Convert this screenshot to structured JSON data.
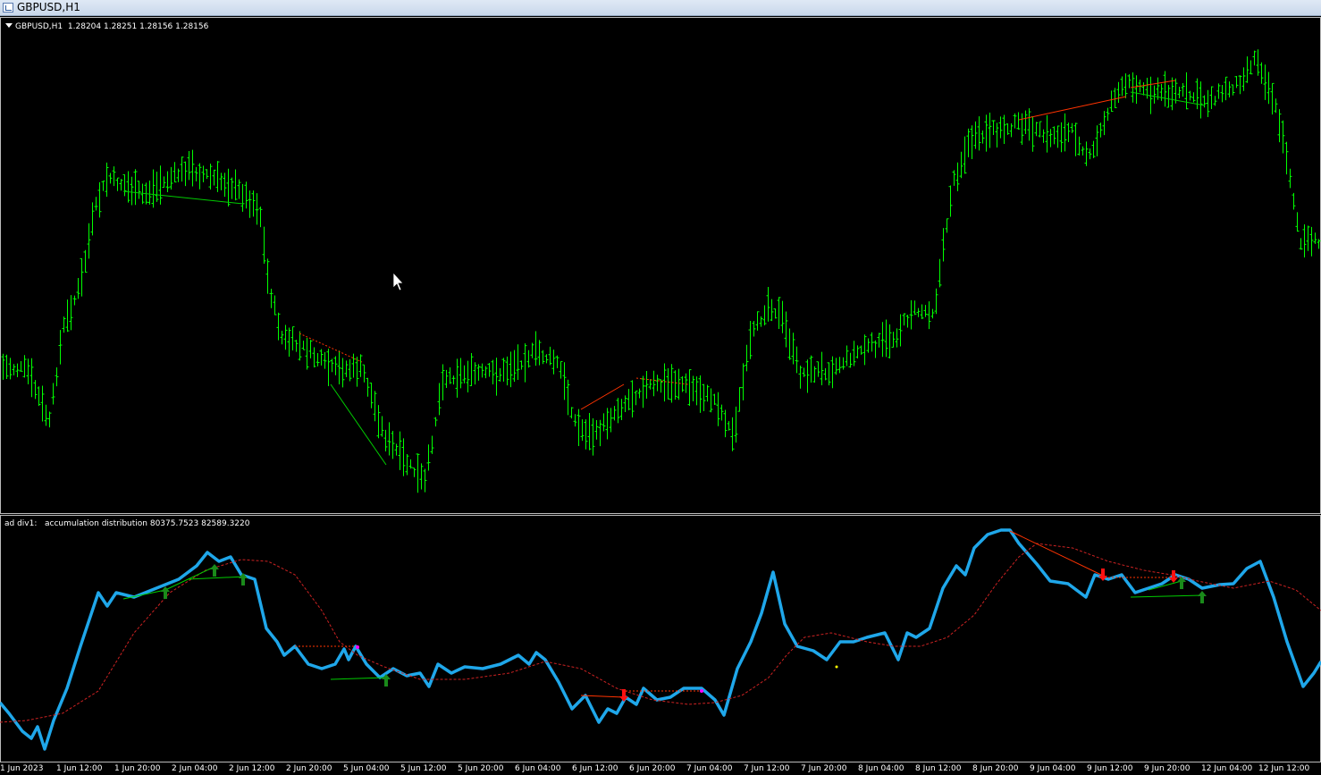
{
  "window": {
    "title": "GBPUSD,H1"
  },
  "main_panel": {
    "symbol": "GBPUSD,H1",
    "ohlc": "1.28204 1.28251 1.28156 1.28156",
    "bar_color": "#00ff00",
    "bearish_div_color": "#ff3300",
    "bullish_div_color": "#00cc00"
  },
  "indicator_panel": {
    "name": "ad div1:",
    "description": "accumulation distribution 80375.7523 82589.3220",
    "line_color": "#1fa7ea",
    "signal_color": "#cc2222",
    "buy_arrow_color": "#1a8a1a",
    "sell_arrow_color": "#ff1111"
  },
  "time_axis": {
    "labels": [
      "1 Jun 2023",
      "1 Jun 12:00",
      "1 Jun 20:00",
      "2 Jun 04:00",
      "2 Jun 12:00",
      "2 Jun 20:00",
      "5 Jun 04:00",
      "5 Jun 12:00",
      "5 Jun 20:00",
      "6 Jun 04:00",
      "6 Jun 12:00",
      "6 Jun 20:00",
      "7 Jun 04:00",
      "7 Jun 12:00",
      "7 Jun 20:00",
      "8 Jun 04:00",
      "8 Jun 12:00",
      "8 Jun 20:00",
      "9 Jun 04:00",
      "9 Jun 12:00",
      "9 Jun 20:00",
      "12 Jun 04:00",
      "12 Jun 12:00"
    ]
  },
  "chart_data": {
    "type": "candlestick",
    "symbol": "GBPUSD",
    "timeframe": "H1",
    "ohlc_last": [
      1.28204,
      1.28251,
      1.28156,
      1.28156
    ],
    "indicator": {
      "name": "accumulation distribution",
      "values": [
        80375.7523,
        82589.322
      ]
    }
  }
}
